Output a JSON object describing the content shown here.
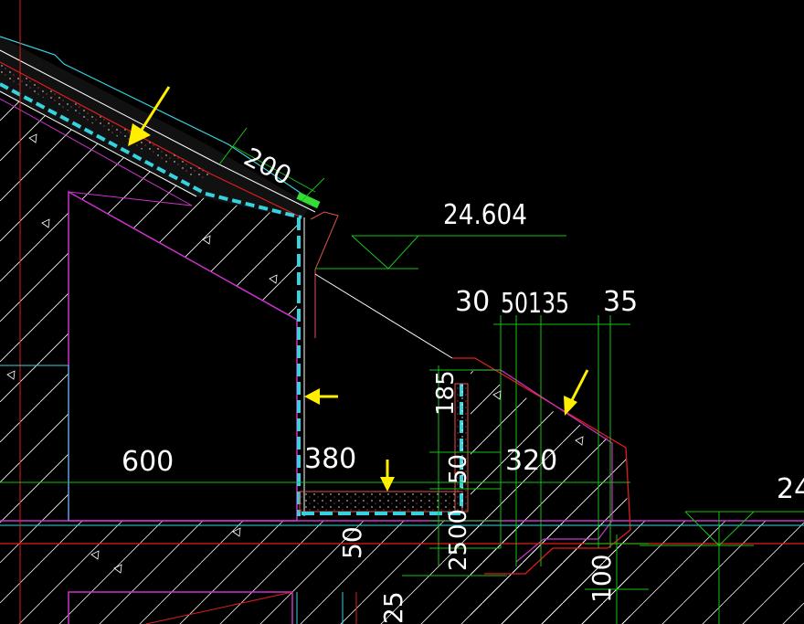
{
  "drawing": {
    "background": "#000000",
    "colors": {
      "hatch": "#ffffff",
      "wall_outline": "#cc33cc",
      "red_line": "#e01e1e",
      "dim_line": "#19c019",
      "cyan": "#35d3df",
      "yellow_arrow": "#ffee00",
      "waterproof": "#e05050",
      "green_mark": "#33dd33"
    },
    "labels": {
      "elevation_top": "24.604",
      "elevation_right": "24",
      "dim_200": "200",
      "dim_30": "30",
      "dim_50135": "50135",
      "dim_35": "35",
      "dim_600": "600",
      "dim_380": "380",
      "dim_320": "320",
      "dim_50_bottom": "50",
      "dim_100": "100",
      "dim_25": "25",
      "dim_185_v": "185",
      "dim_50_v": "50",
      "dim_00_v": "00",
      "dim_25_v": "25"
    },
    "arrows": [
      "arrow-roof-slope",
      "arrow-gutter-wall",
      "arrow-gutter-floor",
      "arrow-right-slope"
    ]
  }
}
